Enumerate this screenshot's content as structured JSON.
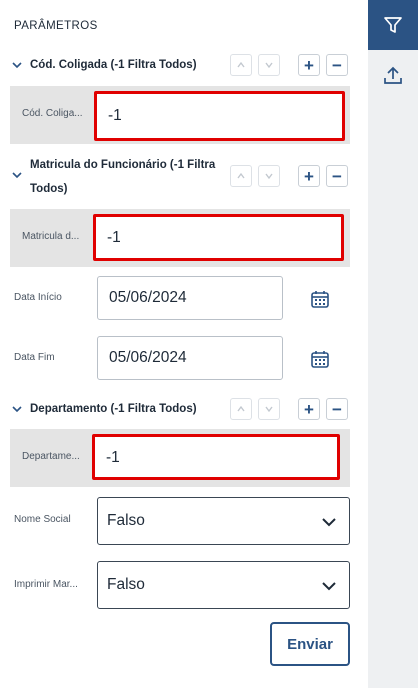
{
  "params_title": "PARÂMETROS",
  "sections": [
    {
      "title": "Cód. Coligada (-1 Filtra Todos)",
      "field_label": "Cód. Coliga...",
      "value": "-1"
    },
    {
      "title_line1": "Matricula do Funcionário (-1 Filtra",
      "title_line2": "Todos)",
      "field_label": "Matricula d...",
      "value": "-1"
    },
    {
      "title": "Departamento (-1 Filtra Todos)",
      "field_label": "Departame...",
      "value": "-1"
    }
  ],
  "date_start": {
    "label": "Data Início",
    "value": "05/06/2024"
  },
  "date_end": {
    "label": "Data Fim",
    "value": "05/06/2024"
  },
  "nome_social": {
    "label": "Nome Social",
    "value": "Falso"
  },
  "imprimir": {
    "label": "Imprimir Mar...",
    "value": "Falso"
  },
  "send_label": "Enviar",
  "colors": {
    "accent": "#2b5384",
    "highlight": "#e00000",
    "grey_row": "#e4e4e4"
  },
  "icons": {
    "sidebar_top": "filter-icon",
    "sidebar_second": "upload-icon"
  }
}
